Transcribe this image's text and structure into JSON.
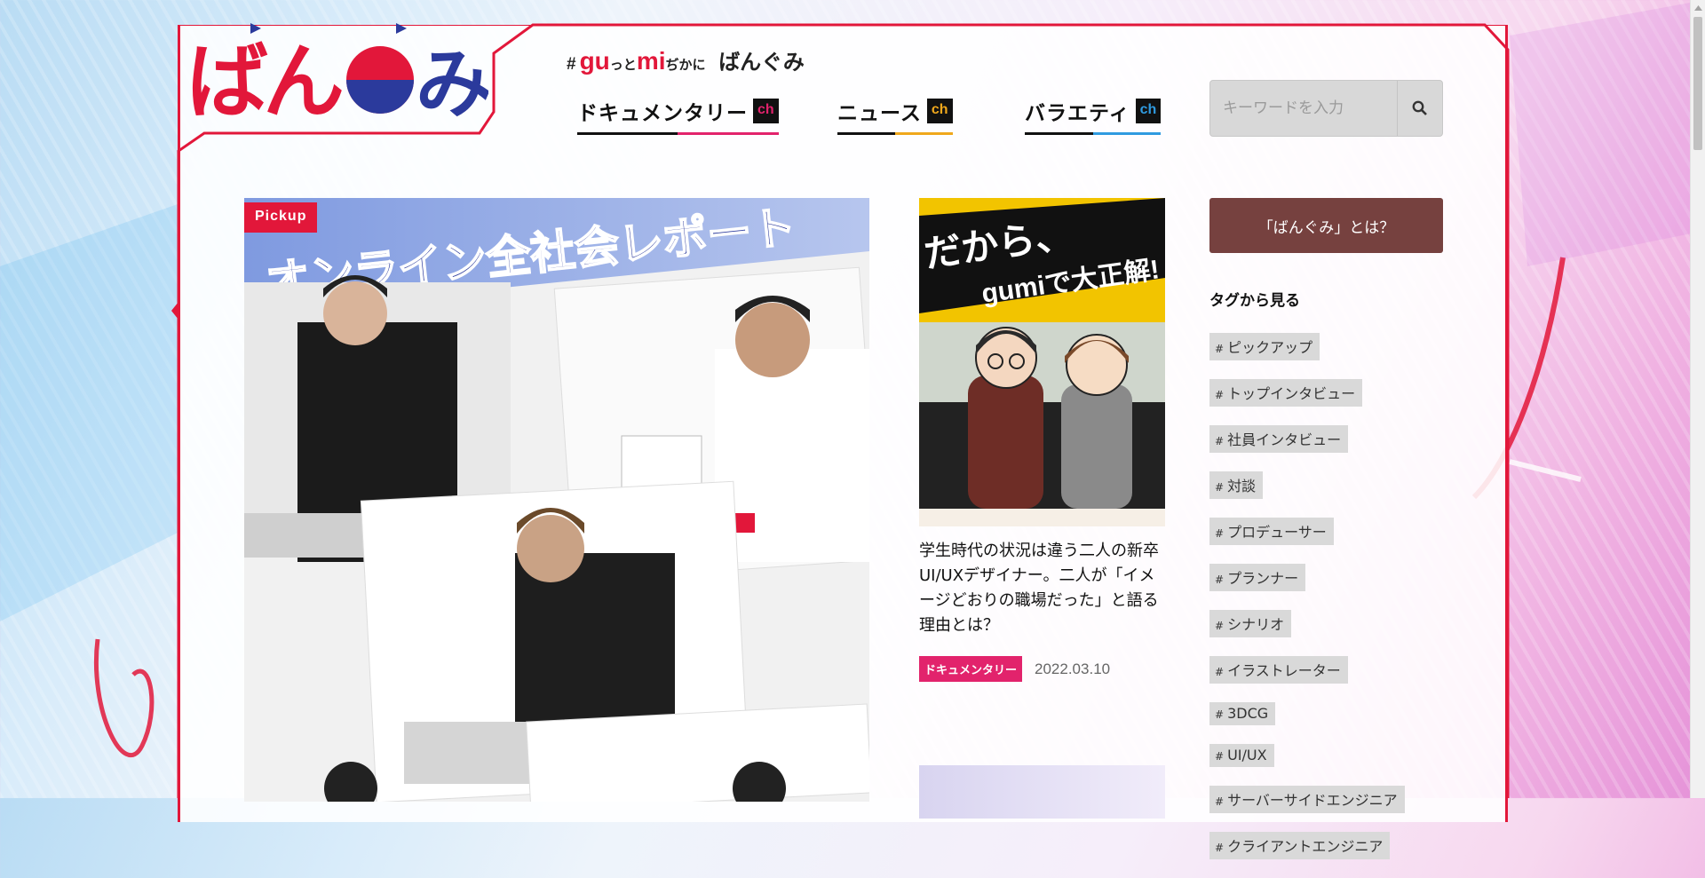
{
  "brand": {
    "logo_text": "ばんぐみ",
    "tagline_hash": "#",
    "tagline_gu": "gu",
    "tagline_tto": "っと",
    "tagline_mi": "mi",
    "tagline_chika": "ぢかに",
    "tagline_name": "ばんぐみ"
  },
  "nav": [
    {
      "label": "ドキュメンタリー",
      "ch": "ch",
      "ch_color": "#e2236c"
    },
    {
      "label": "ニュース",
      "ch": "ch",
      "ch_color": "#f0a81c"
    },
    {
      "label": "バラエティ",
      "ch": "ch",
      "ch_color": "#2f9be0"
    }
  ],
  "search": {
    "placeholder": "キーワードを入力"
  },
  "pickup": {
    "badge": "Pickup",
    "banner_text": "オンライン全社会レポート"
  },
  "article": {
    "thumb_text_line1": "だから、",
    "thumb_text_line2": "gumiで大正解!",
    "title": "学生時代の状況は違う二人の新卒UI/UXデザイナー。二人が「イメージどおりの職場だった」と語る理由とは？",
    "category": "ドキュメンタリー",
    "date": "2022.03.10"
  },
  "sidebar": {
    "about_button": "「ばんぐみ」とは？",
    "tags_heading": "タグから見る",
    "tags": [
      "ピックアップ",
      "トップインタビュー",
      "社員インタビュー",
      "対談",
      "プロデューサー",
      "プランナー",
      "シナリオ",
      "イラストレーター",
      "3DCG",
      "UI/UX",
      "サーバーサイドエンジニア",
      "クライアントエンジニア"
    ]
  },
  "colors": {
    "accent": "#e2173a",
    "brand_blue": "#2b3a9c",
    "about_button": "#76413f"
  }
}
